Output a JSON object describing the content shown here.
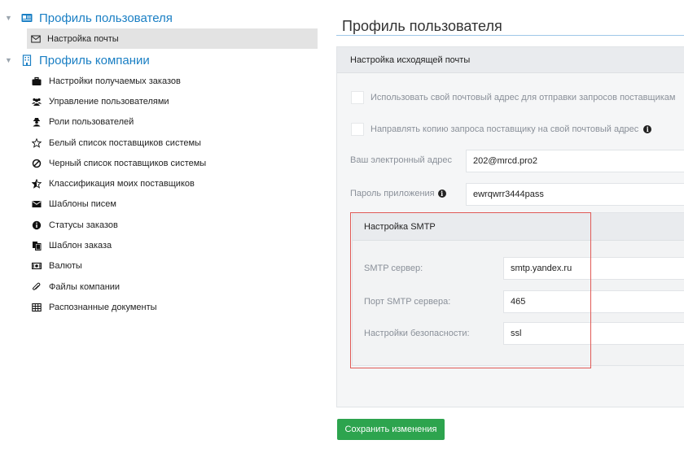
{
  "sidebar": {
    "user_profile": {
      "label": "Профиль пользователя"
    },
    "mail_settings": {
      "label": "Настройка почты"
    },
    "company_profile": {
      "label": "Профиль компании"
    },
    "items": [
      {
        "label": "Настройки получаемых заказов",
        "icon": "briefcase-icon"
      },
      {
        "label": "Управление пользователями",
        "icon": "users-icon"
      },
      {
        "label": "Роли пользователей",
        "icon": "user-secret-icon"
      },
      {
        "label": "Белый список поставщиков системы",
        "icon": "star-outline-icon"
      },
      {
        "label": "Черный список поставщиков системы",
        "icon": "ban-icon"
      },
      {
        "label": "Классификация моих поставщиков",
        "icon": "star-half-icon"
      },
      {
        "label": "Шаблоны писем",
        "icon": "envelope-icon"
      },
      {
        "label": "Статусы заказов",
        "icon": "info-circle-icon"
      },
      {
        "label": "Шаблон заказа",
        "icon": "copy-icon"
      },
      {
        "label": "Валюты",
        "icon": "money-icon"
      },
      {
        "label": "Файлы компании",
        "icon": "paperclip-icon"
      },
      {
        "label": "Распознанные документы",
        "icon": "table-icon"
      }
    ]
  },
  "main": {
    "title": "Профиль пользователя",
    "panel_title": "Настройка исходящей почты",
    "own_address_checkbox": "Использовать свой почтовый адрес для отправки запросов поставщикам",
    "copy_checkbox": "Направлять копию запроса поставщику на свой почтовый адрес",
    "email_label": "Ваш электронный адрес",
    "email_value": "202@mrcd.pro2",
    "app_password_label": "Пароль приложения",
    "app_password_value": "ewrqwrr3444pass",
    "smtp": {
      "title": "Настройка SMTP",
      "server_label": "SMTP сервер:",
      "server_value": "smtp.yandex.ru",
      "port_label": "Порт SMTP сервера:",
      "port_value": "465",
      "security_label": "Настройки безопасности:",
      "security_value": "ssl"
    },
    "save_label": "Сохранить изменения"
  },
  "colors": {
    "accent": "#1a7fc4",
    "save_button": "#2da44e",
    "highlight": "#e05a56"
  }
}
